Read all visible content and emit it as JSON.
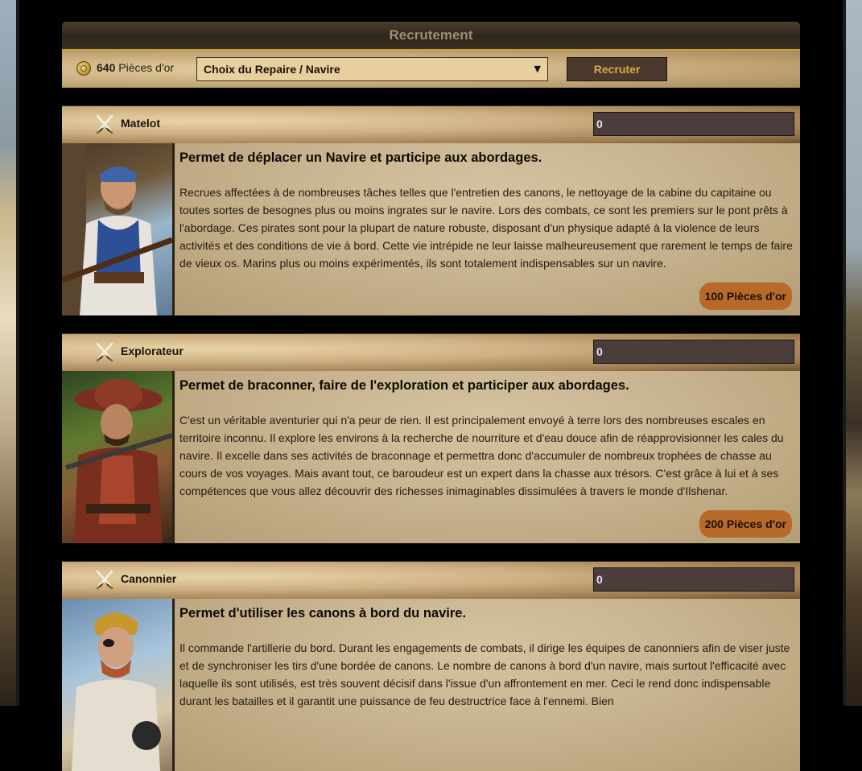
{
  "header": {
    "title": "Recrutement"
  },
  "recruit_bar": {
    "gold_amount": "640",
    "gold_label": "Pièces d'or",
    "repaire_select": "Choix du Repaire / Navire",
    "recruit_button": "Recruter"
  },
  "units": [
    {
      "name": "Matelot",
      "quantity": "0",
      "headline": "Permet de déplacer un Navire et participe aux abordages.",
      "description": "Recrues affectées à de nombreuses tâches telles que l'entretien des canons, le nettoyage de la cabine du capitaine ou toutes sortes de besognes plus ou moins ingrates sur le navire. Lors des combats, ce sont les premiers sur le pont prêts à l'abordage. Ces pirates sont pour la plupart de nature robuste, disposant d'un physique adapté à la violence de leurs activités et des conditions de vie à bord. Cette vie intrépide ne leur laisse malheureusement que rarement le temps de faire de vieux os. Marins plus ou moins expérimentés, ils sont totalement indispensables sur un navire.",
      "price": "100 Pièces d'or"
    },
    {
      "name": "Explorateur",
      "quantity": "0",
      "headline": "Permet de braconner, faire de l'exploration et participer aux abordages.",
      "description": "C'est un véritable aventurier qui n'a peur de rien. Il est principalement envoyé à terre lors des nombreuses escales en territoire inconnu. Il explore les environs à la recherche de nourriture et d'eau douce afin de réapprovisionner les cales du navire. Il excelle dans ses activités de braconnage et permettra donc d'accumuler de nombreux trophées de chasse au cours de vos voyages. Mais avant tout, ce baroudeur est un expert dans la chasse aux trésors. C'est grâce à lui et à ses compétences que vous allez découvrir des richesses inimaginables dissimulées à travers le monde d'Ilshenar.",
      "price": "200 Pièces d'or"
    },
    {
      "name": "Canonnier",
      "quantity": "0",
      "headline": "Permet d'utiliser les canons à bord du navire.",
      "description": "Il commande l'artillerie du bord. Durant les engagements de combats, il dirige les équipes de canonniers afin de viser juste et de synchroniser les tirs d'une bordée de canons. Le nombre de canons à bord d'un navire, mais surtout l'efficacité avec laquelle ils sont utilisés, est très souvent décisif dans l'issue d'un affrontement en mer. Ceci le rend donc indispensable durant les batailles et il garantit une puissance de feu destructrice face à l'ennemi. Bien",
      "price": ""
    }
  ]
}
